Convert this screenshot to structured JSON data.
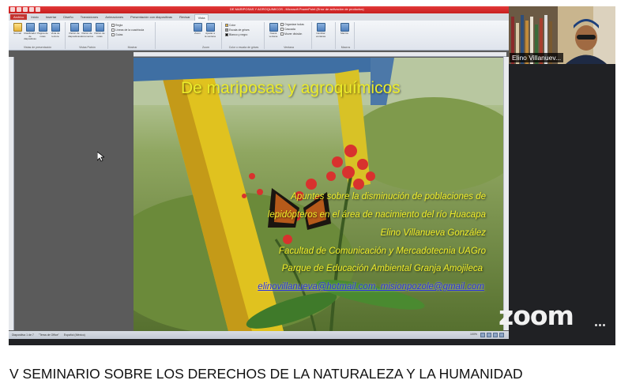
{
  "window": {
    "title": "DE MARIPOSAS Y AGROQUIMICOS - Microsoft PowerPoint (Error de activación de productos)"
  },
  "ribbon": {
    "tabs": [
      "Archivo",
      "Inicio",
      "Insertar",
      "Diseño",
      "Transiciones",
      "Animaciones",
      "Presentación con diapositivas",
      "Revisar",
      "Vista"
    ],
    "active_tab": "Vista",
    "groups": [
      {
        "label": "Vistas de presentación",
        "buttons": [
          "Normal",
          "Clasificador de diapositivas",
          "Página de notas",
          "Vista de lectura"
        ]
      },
      {
        "label": "Vistas Patrón",
        "buttons": [
          "Patrón de diapositivas",
          "Patrón de documentos",
          "Patrón de notas"
        ]
      },
      {
        "label": "Mostrar",
        "checks": [
          "Regla",
          "Líneas de la cuadrícula",
          "Guías"
        ]
      },
      {
        "label": "Zoom",
        "buttons": [
          "Zoom",
          "Ajustar a la ventana"
        ]
      },
      {
        "label": "Color o escala de grises",
        "options": [
          "Color",
          "Escala de grises",
          "Blanco y negro"
        ]
      },
      {
        "label": "Ventana",
        "buttons": [
          "Nueva ventana"
        ],
        "options": [
          "Organizar todas",
          "Cascada",
          "Mover división"
        ]
      },
      {
        "label": "Ventana",
        "buttons": [
          "Cambiar ventanas"
        ]
      },
      {
        "label": "Macros",
        "buttons": [
          "Macros"
        ]
      }
    ]
  },
  "slide": {
    "title": "De mariposas y agroquímicos",
    "lines": [
      "Apuntes sobre la disminución de poblaciones de",
      "lepidópteros en el área de nacimiento del río Huacapa",
      "Elino Villanueva González",
      "Facultad de Comunicación y Mercadotecnia UAGro",
      "Parque de Educación Ambiental Granja Amojileca"
    ],
    "email": "elinovillanueva@hotmail.com, misionpozole@gmail.com"
  },
  "statusbar": {
    "slide_counter": "Diapositiva 1 de 7",
    "theme": "\"Tema de Office\"",
    "language": "Español (México)",
    "zoom": "100%"
  },
  "participant": {
    "name": "Elino Villanuev..."
  },
  "zoom_watermark": "zoom",
  "video_caption": "V SEMINARIO SOBRE LOS DERECHOS DE LA NATURALEZA Y LA HUMANIDAD",
  "colors": {
    "title_bar": "#c81e1e",
    "slide_title": "#ecec2a",
    "slide_text": "#f2ef2a",
    "email": "#2a33d8"
  }
}
